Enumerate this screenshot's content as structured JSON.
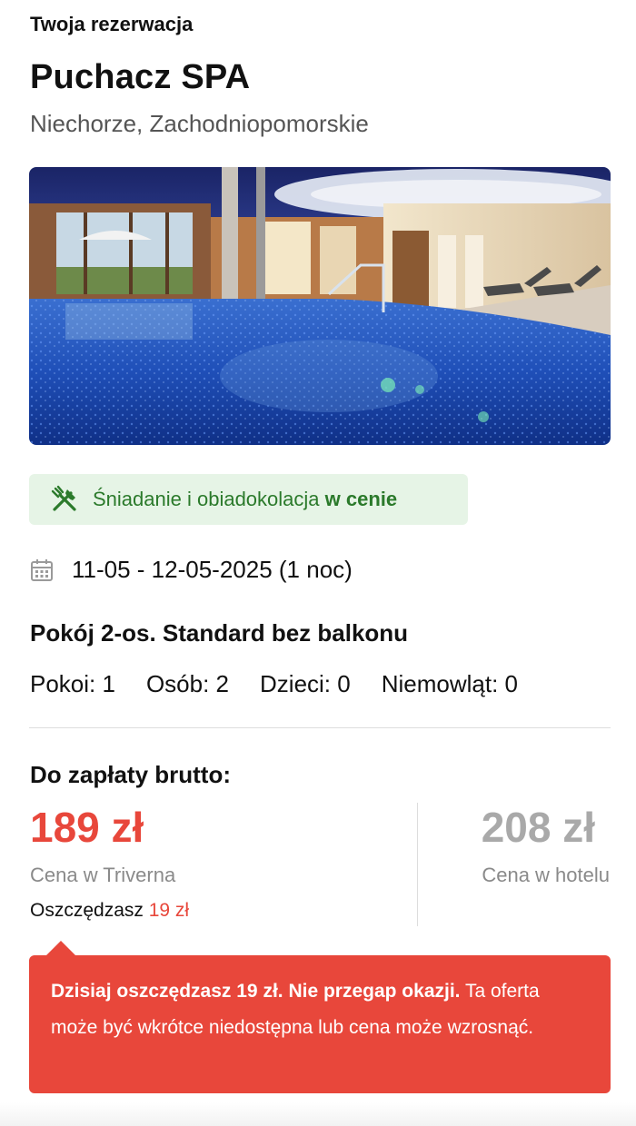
{
  "header": {
    "eyebrow": "Twoja rezerwacja",
    "hotel_name": "Puchacz SPA",
    "location": "Niechorze, Zachodniopomorskie"
  },
  "photo": {
    "icon": "hotel-pool-photo"
  },
  "meal_badge": {
    "icon": "fork-knife-icon",
    "text": "Śniadanie i obiadokolacja ",
    "strong": "w cenie",
    "color": "#2b7a2b",
    "background": "#e6f4e6"
  },
  "stay": {
    "icon": "calendar-icon",
    "dates": "11-05 - 12-05-2025 (1 noc)"
  },
  "room": {
    "name": "Pokój 2-os. Standard bez balkonu",
    "occupancy": [
      "Pokoi: 1",
      "Osób: 2",
      "Dzieci: 0",
      "Niemowląt: 0"
    ]
  },
  "pricing": {
    "due_label": "Do zapłaty brutto:",
    "our_price": "189 zł",
    "our_price_label": "Cena w Triverna",
    "savings_label": "Oszczędzasz",
    "savings_amount": "19 zł",
    "hotel_price": "208 zł",
    "hotel_price_label": "Cena w hotelu",
    "accent_color": "#e8473b"
  },
  "alert": {
    "strong": "Dzisiaj oszczędzasz 19 zł. Nie przegap okazji.",
    "text": " Ta oferta może być wkrótce niedostępna lub cena może wzrosnąć."
  }
}
